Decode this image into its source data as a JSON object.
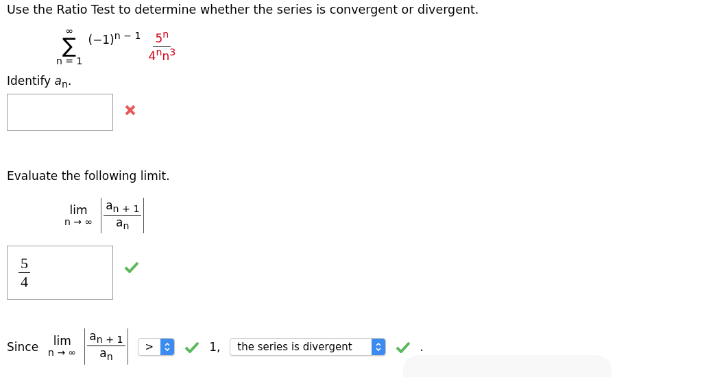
{
  "question": "Use the Ratio Test to determine whether the series is convergent or divergent.",
  "series": {
    "upper": "∞",
    "sigma": "∑",
    "lower": "n = 1",
    "sign_factor": "(−1)$^{n − 1}$",
    "numerator": "5$^{n}$",
    "denominator": "4$^{n}$n$^{3}$"
  },
  "identify": {
    "label": "Identify *a*$_{n}$.",
    "correct": false
  },
  "evaluate": {
    "label": "Evaluate the following limit.",
    "lim": "lim",
    "under": "n → ∞",
    "numerator": "a$_{n + 1}$",
    "denominator": "a$_{n}$"
  },
  "answer": {
    "numerator": "5",
    "denominator": "4",
    "correct": true
  },
  "conclusion": {
    "since": "Since",
    "lim": "lim",
    "under": "n → ∞",
    "numerator": "a$_{n + 1}$",
    "denominator": "a$_{n}$",
    "comparison": {
      "value": ">",
      "correct": true
    },
    "one": "1,",
    "verdict": {
      "value": "the series is divergent",
      "correct": true
    },
    "period": "."
  }
}
